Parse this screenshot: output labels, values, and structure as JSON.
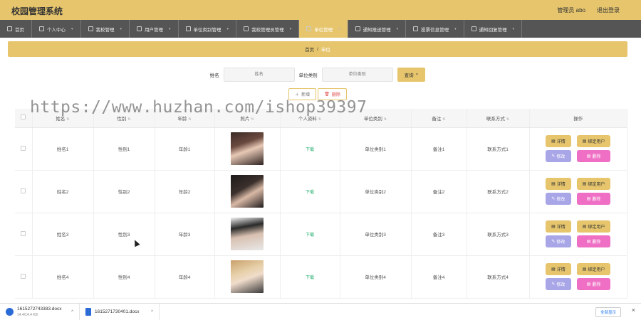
{
  "header": {
    "title": "校园管理系统",
    "user": "管理员 abo",
    "logout": "退出登录"
  },
  "nav": [
    {
      "label": "首页"
    },
    {
      "label": "个人中心"
    },
    {
      "label": "我校管理"
    },
    {
      "label": "用户管理"
    },
    {
      "label": "单位类别管理"
    },
    {
      "label": "我校管理员管理"
    },
    {
      "label": "单位管理"
    },
    {
      "label": "通知推送管理"
    },
    {
      "label": "投票信息管理"
    },
    {
      "label": "通知回复管理"
    }
  ],
  "breadcrumb": {
    "home": "首页",
    "separator": "/",
    "current": "单位"
  },
  "search": {
    "name_label": "姓名",
    "name_placeholder": "姓名",
    "category_label": "单位类别",
    "category_placeholder": "单位类别",
    "button": "查询"
  },
  "actions": {
    "add": "新增",
    "delete": "删除"
  },
  "table": {
    "columns": [
      "姓名",
      "性别",
      "年龄",
      "照片",
      "个人资料",
      "单位类别",
      "备注",
      "联系方式",
      "操作"
    ],
    "rows": [
      {
        "name": "姓名1",
        "gender": "性别1",
        "age": "年龄1",
        "file": "下载",
        "category": "单位类别1",
        "note": "备注1",
        "contact": "联系方式1"
      },
      {
        "name": "姓名2",
        "gender": "性别2",
        "age": "年龄2",
        "file": "下载",
        "category": "单位类别2",
        "note": "备注2",
        "contact": "联系方式2"
      },
      {
        "name": "姓名3",
        "gender": "性别3",
        "age": "年龄3",
        "file": "下载",
        "category": "单位类别3",
        "note": "备注3",
        "contact": "联系方式3"
      },
      {
        "name": "姓名4",
        "gender": "性别4",
        "age": "年龄4",
        "file": "下载",
        "category": "单位类别4",
        "note": "备注4",
        "contact": "联系方式4"
      }
    ],
    "ops": {
      "detail": "详情",
      "bind": "绑定用户",
      "edit": "修改",
      "remove": "删除"
    }
  },
  "watermark": "https://www.huzhan.com/ishop39397",
  "downloads": [
    {
      "name": "1615272743383.docx",
      "size": "14.4/14.4 KB"
    },
    {
      "name": "1615271730401.docx"
    }
  ],
  "downloads_show_all": "全部显示",
  "colors": {
    "accent": "#e6c56d",
    "nav_bg": "#555555",
    "edit": "#a9a6e8",
    "remove": "#ee6fc4",
    "download_link": "#1fae6c"
  }
}
